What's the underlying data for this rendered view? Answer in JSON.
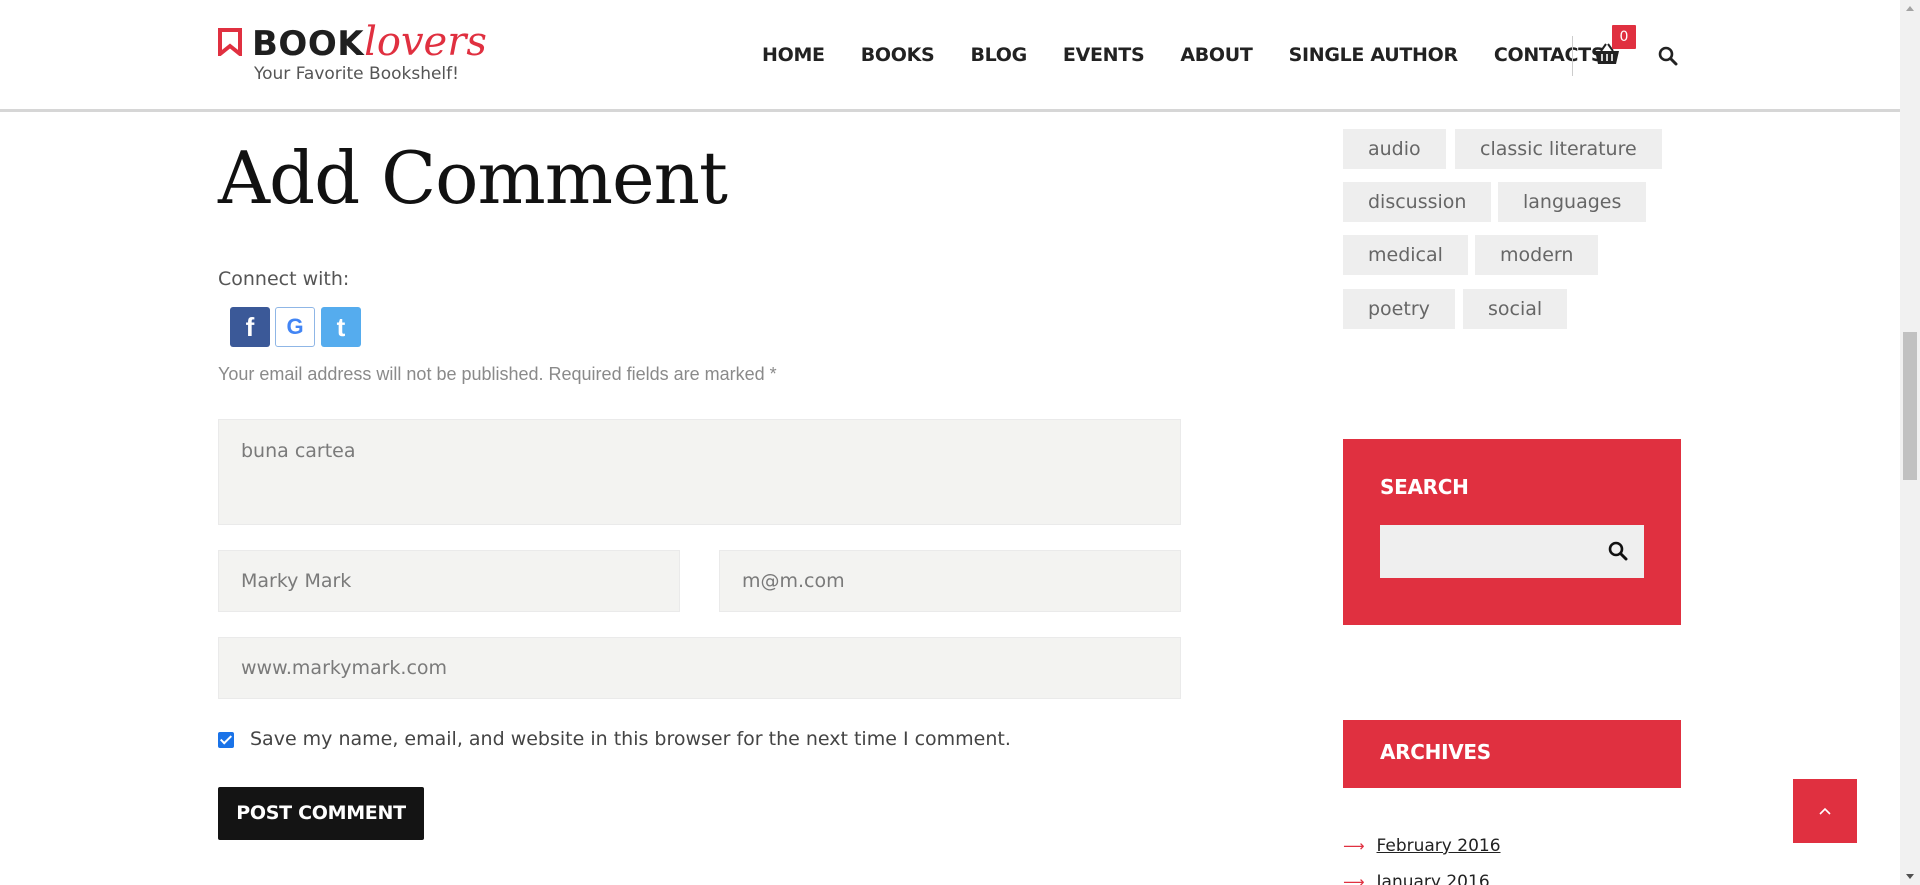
{
  "header": {
    "logo_book": "BOOK",
    "logo_lovers": "lovers",
    "tagline": "Your Favorite Bookshelf!",
    "nav": [
      "HOME",
      "BOOKS",
      "BLOG",
      "EVENTS",
      "ABOUT",
      "SINGLE AUTHOR",
      "CONTACTS"
    ],
    "cart_count": "0",
    "icons": {
      "cart": "shopping-basket-icon",
      "search": "search-icon"
    }
  },
  "comment_form": {
    "title": "Add Comment",
    "connect_label": "Connect with:",
    "social": [
      "facebook",
      "google",
      "twitter"
    ],
    "email_note": "Your email address will not be published. Required fields are marked *",
    "comment_value": "buna cartea",
    "name_value": "Marky Mark",
    "email_value": "m@m.com",
    "website_value": "www.markymark.com",
    "save_checked": true,
    "save_label": "Save my name, email, and website in this browser for the next time I comment.",
    "submit_label": "POST COMMENT"
  },
  "sidebar": {
    "tags": [
      "audio",
      "classic literature",
      "discussion",
      "languages",
      "medical",
      "modern",
      "poetry",
      "social"
    ],
    "search_title": "SEARCH",
    "archives_title": "ARCHIVES",
    "archives": [
      "February 2016",
      "January 2016"
    ]
  },
  "colors": {
    "accent": "#e03040",
    "dark": "#141414",
    "field_bg": "#f3f3f1",
    "tag_bg": "#eeeeee"
  }
}
